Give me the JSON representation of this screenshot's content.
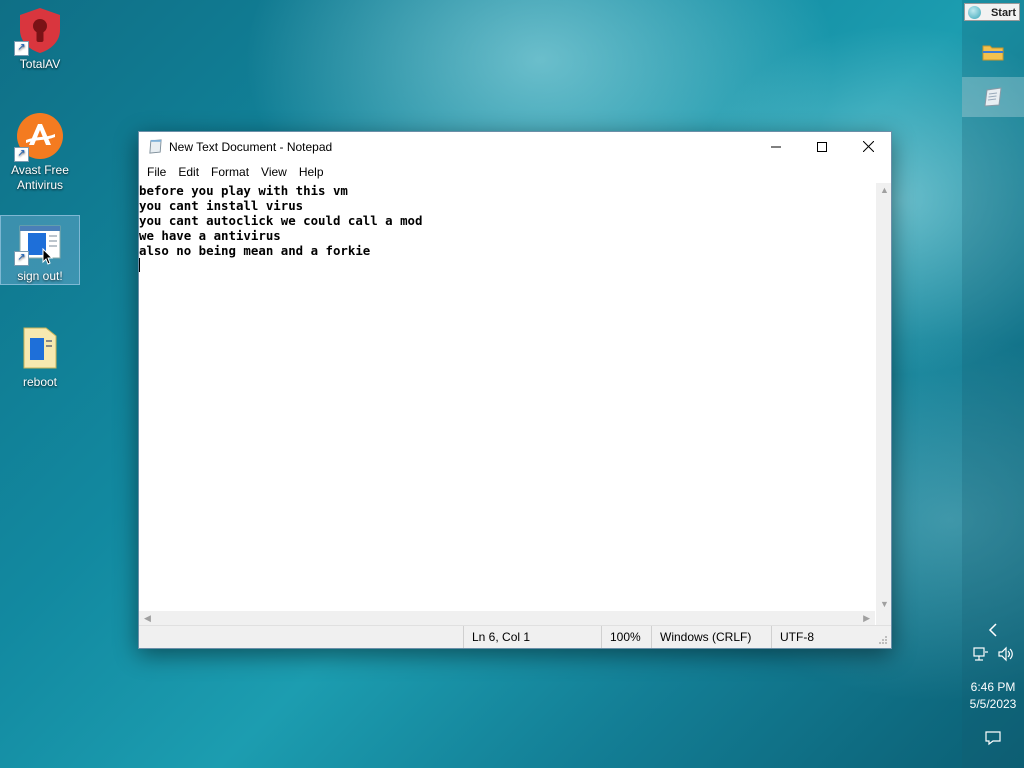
{
  "desktop": {
    "icons": [
      {
        "label": "TotalAV"
      },
      {
        "label": "Avast Free Antivirus"
      },
      {
        "label": "sign out!"
      },
      {
        "label": "reboot"
      }
    ]
  },
  "taskbar": {
    "start_label": "Start",
    "time": "6:46 PM",
    "date": "5/5/2023"
  },
  "notepad": {
    "title": "New Text Document - Notepad",
    "menu": [
      "File",
      "Edit",
      "Format",
      "View",
      "Help"
    ],
    "content_lines": [
      "before you play with this vm",
      "you cant install virus",
      "you cant autoclick we could call a mod",
      "we have a antivirus",
      "also no being mean and a forkie"
    ],
    "status": {
      "position": "Ln 6, Col 1",
      "zoom": "100%",
      "line_ending": "Windows (CRLF)",
      "encoding": "UTF-8"
    }
  },
  "colors": {
    "desktop_accent": "#1289a0",
    "avast_orange": "#f47b20",
    "totalav_red": "#d9363e"
  }
}
